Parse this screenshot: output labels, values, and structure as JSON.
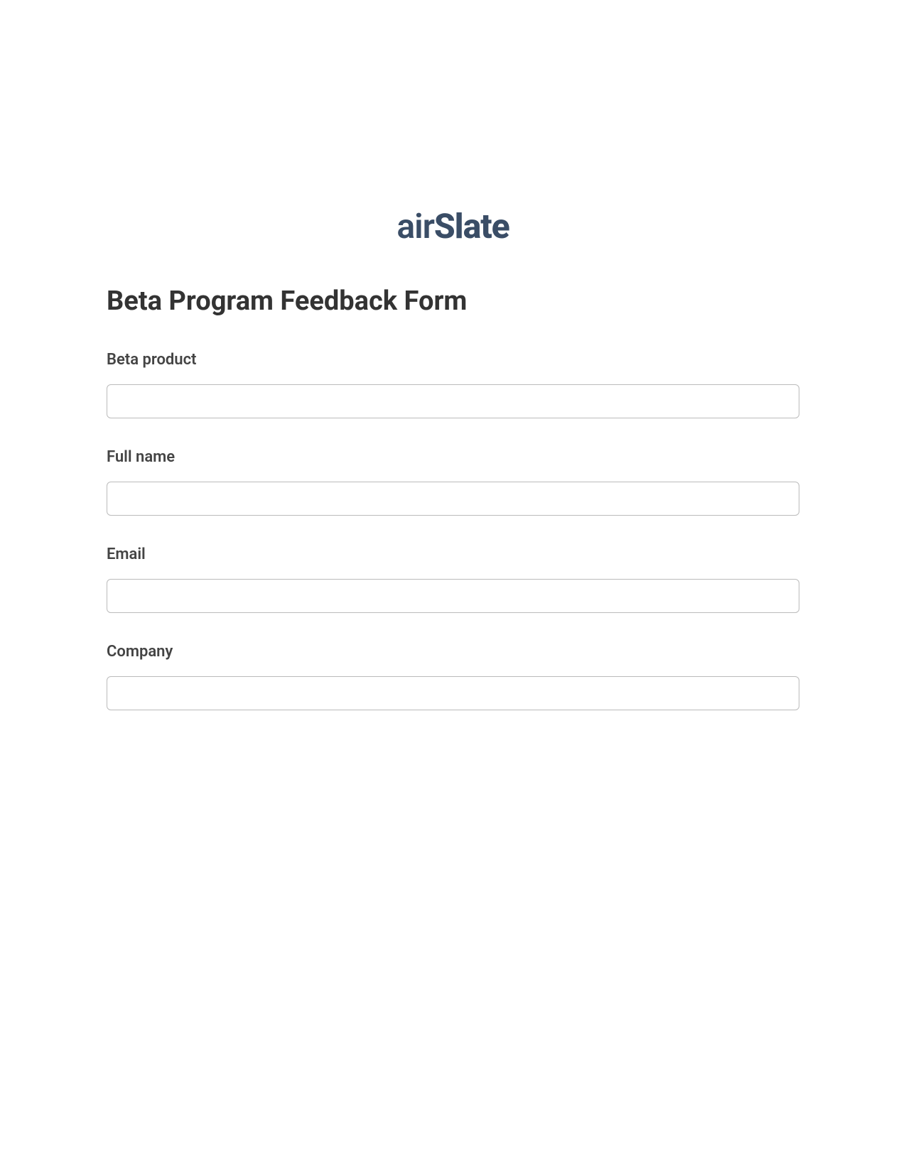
{
  "logo": {
    "text_air": "air",
    "text_slate": "Slate"
  },
  "form": {
    "title": "Beta Program Feedback Form",
    "fields": [
      {
        "label": "Beta product",
        "value": ""
      },
      {
        "label": "Full name",
        "value": ""
      },
      {
        "label": "Email",
        "value": ""
      },
      {
        "label": "Company",
        "value": ""
      }
    ]
  }
}
